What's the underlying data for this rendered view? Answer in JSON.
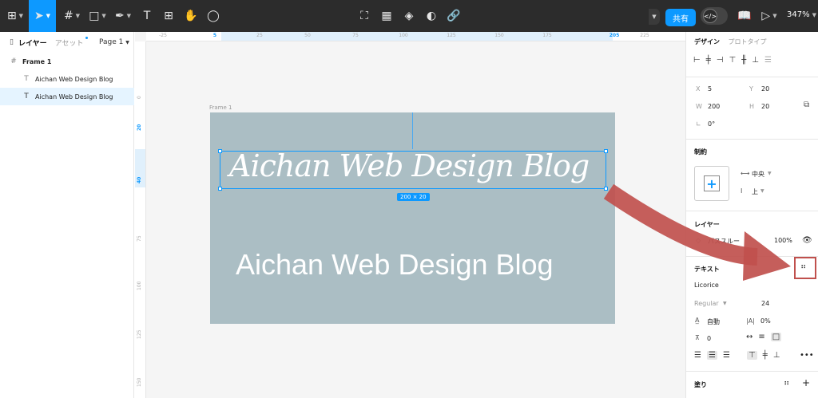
{
  "toolbar": {
    "zoom": "347%",
    "share_label": "共有",
    "dev_mode_icon_text": "</>"
  },
  "left_panel": {
    "tab_layers": "レイヤー",
    "tab_assets": "アセット",
    "page_label": "Page 1",
    "layers": [
      {
        "label": "Frame 1"
      },
      {
        "label": "Aichan Web Design Blog"
      },
      {
        "label": "Aichan Web Design Blog"
      }
    ]
  },
  "canvas": {
    "frame_label": "Frame 1",
    "script_text": "Aichan Web Design Blog",
    "size_badge": "200 × 20",
    "sans_text": "Aichan Web Design Blog",
    "ruler_top": [
      "-25",
      "5",
      "25",
      "50",
      "75",
      "100",
      "125",
      "150",
      "175",
      "205",
      "225"
    ],
    "ruler_left": [
      "0",
      "20",
      "40",
      "75",
      "100",
      "125",
      "150"
    ]
  },
  "right_panel": {
    "tab_design": "デザイン",
    "tab_prototype": "プロトタイプ",
    "x_label": "X",
    "x_value": "5",
    "y_label": "Y",
    "y_value": "20",
    "w_label": "W",
    "w_value": "200",
    "h_label": "H",
    "h_value": "20",
    "rotation": "0°",
    "constraints_title": "制約",
    "constraint_h": "中央",
    "constraint_v": "上",
    "layer_title": "レイヤー",
    "layer_mode": "パススルー",
    "opacity": "100%",
    "text_title": "テキスト",
    "font_family": "Licorice",
    "font_weight": "Regular",
    "font_size": "24",
    "line_height": "自動",
    "letter_spacing": "0%",
    "paragraph_spacing": "0",
    "fill_title": "塗り"
  },
  "colors": {
    "toolbar_bg": "#2c2c2c",
    "accent": "#0d99ff",
    "frame_fill": "#abbec4",
    "arrow": "#c0504d"
  }
}
